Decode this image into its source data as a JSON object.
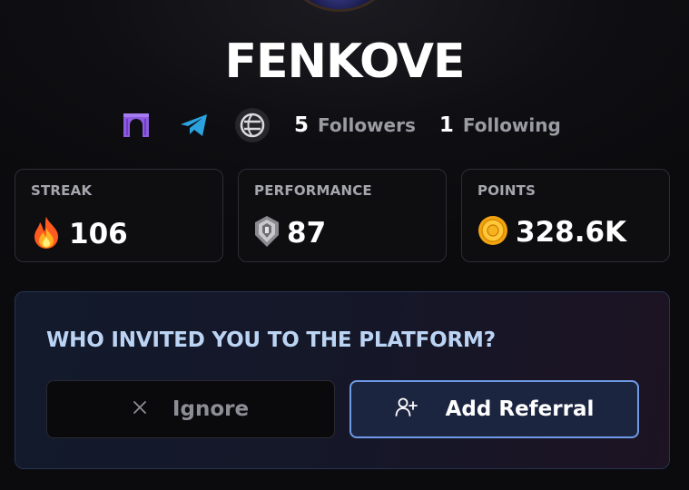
{
  "profile": {
    "username": "FENKOVE"
  },
  "social": {
    "icons": [
      "gate-icon",
      "telegram-icon",
      "globe-icon"
    ],
    "followers_count": "5",
    "followers_label": "Followers",
    "following_count": "1",
    "following_label": "Following"
  },
  "stats": {
    "streak": {
      "label": "STREAK",
      "value": "106",
      "icon": "fire-icon"
    },
    "performance": {
      "label": "PERFORMANCE",
      "value": "87",
      "icon": "badge-icon"
    },
    "points": {
      "label": "POINTS",
      "value": "328.6K",
      "icon": "coin-icon"
    }
  },
  "referral": {
    "question": "WHO INVITED YOU TO THE PLATFORM?",
    "ignore_label": "Ignore",
    "add_label": "Add Referral"
  },
  "colors": {
    "accent_blue": "#6f9ae8",
    "question_text": "#bcd4f4",
    "telegram": "#2aa3e0",
    "gate_purple": "#8c5be0"
  }
}
